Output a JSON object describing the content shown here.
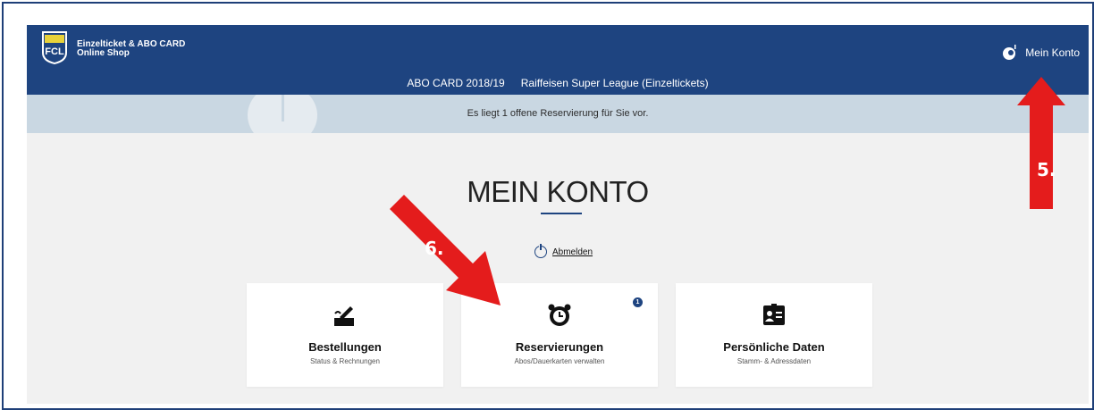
{
  "header": {
    "brand_line1": "Einzelticket & ABO CARD",
    "brand_line2": "Online Shop",
    "logo_text": "FCL",
    "account_label": "Mein Konto",
    "nav": [
      "ABO CARD 2018/19",
      "Raiffeisen Super League (Einzeltickets)"
    ]
  },
  "banner": {
    "text": "Es liegt 1 offene Reservierung für Sie vor."
  },
  "main": {
    "title": "MEIN KONTO",
    "logout_label": "Abmelden"
  },
  "cards": [
    {
      "title": "Bestellungen",
      "subtitle": "Status & Rechnungen",
      "icon": "signature-icon"
    },
    {
      "title": "Reservierungen",
      "subtitle": "Abos/Dauerkarten verwalten",
      "icon": "alarm-clock-icon",
      "badge": "1"
    },
    {
      "title": "Persönliche Daten",
      "subtitle": "Stamm- & Adressdaten",
      "icon": "id-card-icon"
    }
  ],
  "annotations": {
    "step5": "5.",
    "step6": "6."
  },
  "colors": {
    "brand": "#1e4480",
    "banner": "#c9d7e2",
    "arrow": "#e41c1c"
  }
}
